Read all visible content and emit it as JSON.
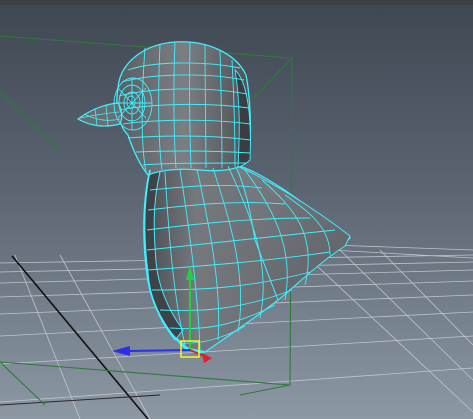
{
  "viewport": {
    "background_top": "#434b57",
    "background_bottom": "#8a95a3",
    "top_bar_color": "#3c3f45"
  },
  "grid": {
    "line_color": "#c9ced4",
    "axis_color": "#111111"
  },
  "bounding_box": {
    "color": "#2e7d3a"
  },
  "mesh": {
    "object": "bird",
    "wire_color": "#3ff0ff",
    "surface_color": "#6a6d70",
    "surface_dark": "#505356",
    "surface_light": "#8c8f92"
  },
  "manipulator": {
    "tool": "move",
    "x_axis_color": "#e0202a",
    "y_axis_color": "#25d040",
    "z_axis_color": "#2a2fe8",
    "center_color": "#ffff22",
    "icons": [
      "move-manipulator-icon",
      "x-axis-arrow-icon",
      "y-axis-arrow-icon",
      "z-axis-arrow-icon"
    ]
  }
}
